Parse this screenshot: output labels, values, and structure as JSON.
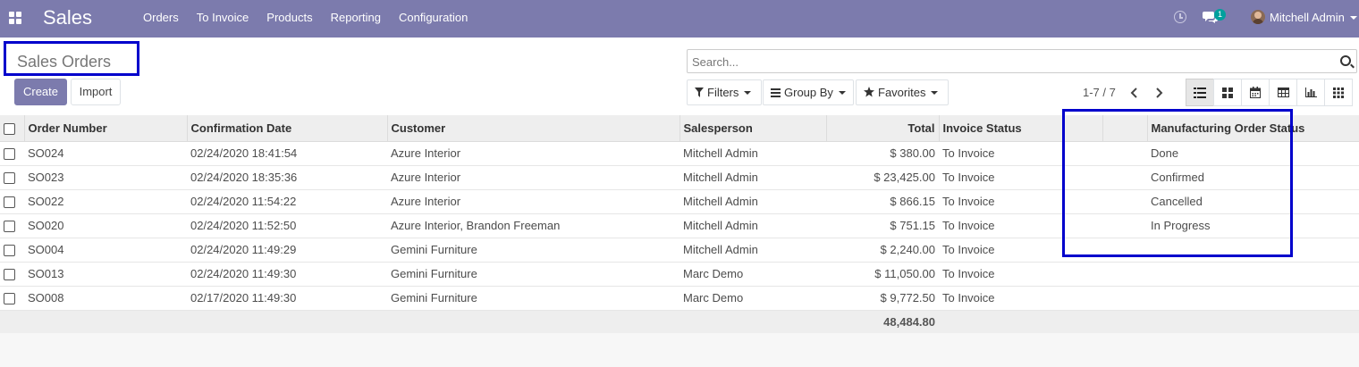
{
  "navbar": {
    "brand": "Sales",
    "menu": [
      "Orders",
      "To Invoice",
      "Products",
      "Reporting",
      "Configuration"
    ],
    "chat_count": "1",
    "user_name": "Mitchell Admin",
    "accent_color": "#7c7bad"
  },
  "control_panel": {
    "title": "Sales Orders",
    "create_label": "Create",
    "import_label": "Import",
    "search_placeholder": "Search...",
    "filters_label": "Filters",
    "group_by_label": "Group By",
    "favorites_label": "Favorites",
    "pager": "1-7 / 7",
    "views": [
      "list-view-icon",
      "kanban-view-icon",
      "calendar-view-icon",
      "pivot-view-icon",
      "graph-view-icon",
      "grid-view-icon"
    ]
  },
  "table": {
    "columns": [
      "Order Number",
      "Confirmation Date",
      "Customer",
      "Salesperson",
      "Total",
      "Invoice Status",
      "",
      "Manufacturing Order Status"
    ],
    "rows": [
      {
        "order": "SO024",
        "date": "02/24/2020 18:41:54",
        "customer": "Azure Interior",
        "salesperson": "Mitchell Admin",
        "total": "$ 380.00",
        "invoice_status": "To Invoice",
        "mo_status": "Done"
      },
      {
        "order": "SO023",
        "date": "02/24/2020 18:35:36",
        "customer": "Azure Interior",
        "salesperson": "Mitchell Admin",
        "total": "$ 23,425.00",
        "invoice_status": "To Invoice",
        "mo_status": "Confirmed"
      },
      {
        "order": "SO022",
        "date": "02/24/2020 11:54:22",
        "customer": "Azure Interior",
        "salesperson": "Mitchell Admin",
        "total": "$ 866.15",
        "invoice_status": "To Invoice",
        "mo_status": "Cancelled"
      },
      {
        "order": "SO020",
        "date": "02/24/2020 11:52:50",
        "customer": "Azure Interior, Brandon Freeman",
        "salesperson": "Mitchell Admin",
        "total": "$ 751.15",
        "invoice_status": "To Invoice",
        "mo_status": "In Progress"
      },
      {
        "order": "SO004",
        "date": "02/24/2020 11:49:29",
        "customer": "Gemini Furniture",
        "salesperson": "Mitchell Admin",
        "total": "$ 2,240.00",
        "invoice_status": "To Invoice",
        "mo_status": ""
      },
      {
        "order": "SO013",
        "date": "02/24/2020 11:49:30",
        "customer": "Gemini Furniture",
        "salesperson": "Marc Demo",
        "total": "$ 11,050.00",
        "invoice_status": "To Invoice",
        "mo_status": ""
      },
      {
        "order": "SO008",
        "date": "02/17/2020 11:49:30",
        "customer": "Gemini Furniture",
        "salesperson": "Marc Demo",
        "total": "$ 9,772.50",
        "invoice_status": "To Invoice",
        "mo_status": ""
      }
    ],
    "sum_total": "48,484.80"
  }
}
